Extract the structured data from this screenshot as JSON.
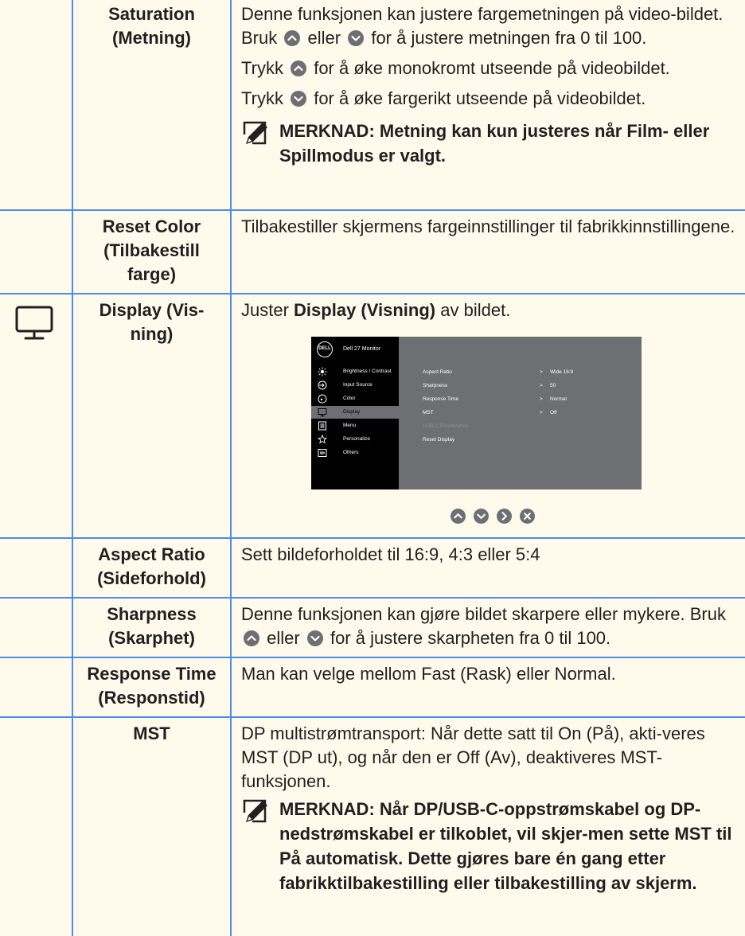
{
  "rows": {
    "saturation": {
      "name": "Saturation (Metning)",
      "p1_a": "Denne funksjonen kan justere fargemetningen på video-bildet. Bruk",
      "p1_b": "eller",
      "p1_c": "for å justere metningen fra 0 til 100.",
      "p2_a": "Trykk",
      "p2_b": "for å øke monokromt utseende på videobildet.",
      "p3_a": "Trykk",
      "p3_b": "for å øke fargerikt utseende på videobildet.",
      "note": "MERKNAD: Metning kan kun justeres når Film- eller Spillmodus er valgt."
    },
    "reset_color": {
      "name": "Reset Color (Tilbakestill farge)",
      "desc": "Tilbakestiller skjermens fargeinnstillinger til fabrikkinnstillingene."
    },
    "display": {
      "name": "Display (Vis-ning)",
      "desc_a": "Juster",
      "desc_b": "Display (Visning)",
      "desc_c": "av bildet."
    },
    "aspect_ratio": {
      "name": "Aspect Ratio (Sideforhold)",
      "desc": "Sett bildeforholdet til 16:9, 4:3 eller 5:4"
    },
    "sharpness": {
      "name": "Sharpness (Skarphet)",
      "desc_a": "Denne funksjonen kan gjøre bildet skarpere eller mykere. Bruk",
      "desc_b": "eller",
      "desc_c": "for å justere skarpheten fra 0 til 100."
    },
    "response_time": {
      "name": "Response Time (Responstid)",
      "desc": "Man kan velge mellom Fast (Rask) eller Normal."
    },
    "mst": {
      "name": "MST",
      "desc": "DP multistrømtransport: Når dette satt til On (På), akti-veres MST (DP ut), og når den er Off (Av), deaktiveres MST-funksjonen.",
      "note": "MERKNAD: Når DP/USB-C-oppstrømskabel og DP-nedstrømskabel er tilkoblet, vil skjer-men sette MST til På automatisk. Dette gjøres bare én gang etter fabrikktilbakestilling eller tilbakestilling av skjerm."
    }
  },
  "osd": {
    "logo": "DELL",
    "title": "Dell 27 Monitor",
    "menu": [
      {
        "label": "Brightness / Contrast",
        "icon": "brightness-icon"
      },
      {
        "label": "Input Source",
        "icon": "input-source-icon"
      },
      {
        "label": "Color",
        "icon": "color-icon"
      },
      {
        "label": "Display",
        "icon": "display-icon",
        "selected": true
      },
      {
        "label": "Menu",
        "icon": "menu-icon"
      },
      {
        "label": "Personalize",
        "icon": "star-icon"
      },
      {
        "label": "Others",
        "icon": "others-icon"
      }
    ],
    "settings": [
      {
        "key": "Aspect Ratio",
        "value": "Wide 16:9"
      },
      {
        "key": "Sharpness",
        "value": "50"
      },
      {
        "key": "Response Time",
        "value": "Normal"
      },
      {
        "key": "MST",
        "value": "Off"
      },
      {
        "key": "USB-C Prioritization",
        "value": ""
      },
      {
        "key": "Reset Display",
        "value": ""
      }
    ],
    "arrow": ">",
    "buttons": [
      "up-button-icon",
      "down-button-icon",
      "right-button-icon",
      "close-button-icon"
    ]
  },
  "colors": {
    "background": "#fffaec",
    "border": "#4b8ee8",
    "osd_left": "#000000",
    "osd_panel": "#6d6f72",
    "button": "#6d6f72"
  }
}
